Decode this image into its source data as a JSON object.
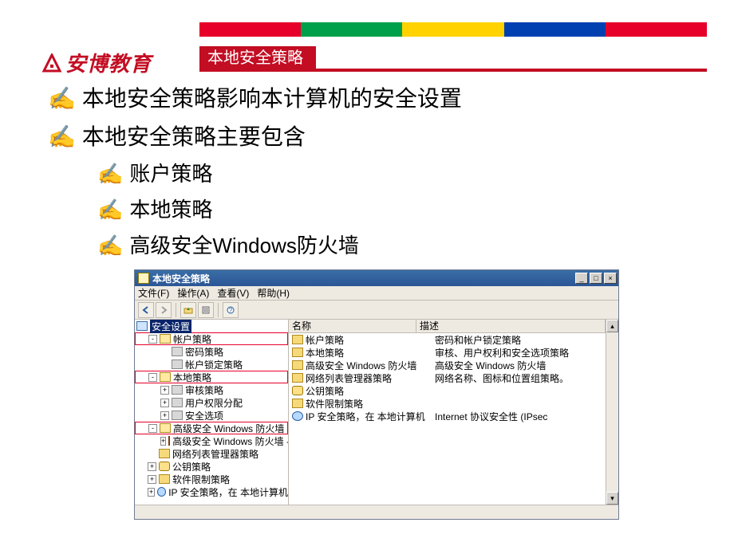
{
  "slide": {
    "logo_text": "安博教育",
    "title": "本地安全策略",
    "bullets_level1": [
      "本地安全策略影响本计算机的安全设置",
      "本地安全策略主要包含"
    ],
    "bullets_level2": [
      "账户策略",
      "本地策略",
      "高级安全Windows防火墙"
    ]
  },
  "mmc": {
    "window_title": "本地安全策略",
    "menu": {
      "file": "文件(F)",
      "action": "操作(A)",
      "view": "查看(V)",
      "help": "帮助(H)"
    },
    "sysbuttons": {
      "min": "_",
      "max": "□",
      "close": "×"
    },
    "tree": {
      "root": "安全设置",
      "nodes": [
        {
          "pm": "-",
          "icon": "folderopen",
          "label": "帐户策略",
          "highlight": true,
          "depth": 1
        },
        {
          "pm": "",
          "icon": "node",
          "label": "密码策略",
          "depth": 2
        },
        {
          "pm": "",
          "icon": "node",
          "label": "帐户锁定策略",
          "depth": 2
        },
        {
          "pm": "-",
          "icon": "folderopen",
          "label": "本地策略",
          "highlight": true,
          "depth": 1
        },
        {
          "pm": "+",
          "icon": "node",
          "label": "审核策略",
          "depth": 2
        },
        {
          "pm": "+",
          "icon": "node",
          "label": "用户权限分配",
          "depth": 2
        },
        {
          "pm": "+",
          "icon": "node",
          "label": "安全选项",
          "depth": 2
        },
        {
          "pm": "-",
          "icon": "folderopen",
          "label": "高级安全 Windows 防火墙",
          "highlight": true,
          "depth": 1
        },
        {
          "pm": "+",
          "icon": "wall",
          "label": "高级安全 Windows 防火墙 - 本地",
          "depth": 2
        },
        {
          "pm": "",
          "icon": "folder",
          "label": "网络列表管理器策略",
          "depth": 1
        },
        {
          "pm": "+",
          "icon": "key",
          "label": "公钥策略",
          "depth": 1
        },
        {
          "pm": "+",
          "icon": "folder",
          "label": "软件限制策略",
          "depth": 1
        },
        {
          "pm": "+",
          "icon": "globe",
          "label": "IP 安全策略，在 本地计算机",
          "depth": 1
        }
      ]
    },
    "list": {
      "col_name": "名称",
      "col_desc": "描述",
      "rows": [
        {
          "icon": "folder",
          "name": "帐户策略",
          "desc": "密码和帐户锁定策略"
        },
        {
          "icon": "folder",
          "name": "本地策略",
          "desc": "审核、用户权利和安全选项策略"
        },
        {
          "icon": "folder",
          "name": "高级安全 Windows 防火墙",
          "desc": "高级安全 Windows 防火墙"
        },
        {
          "icon": "folder",
          "name": "网络列表管理器策略",
          "desc": "网络名称、图标和位置组策略。"
        },
        {
          "icon": "key",
          "name": "公钥策略",
          "desc": ""
        },
        {
          "icon": "folder",
          "name": "软件限制策略",
          "desc": ""
        },
        {
          "icon": "globe",
          "name": "IP 安全策略，在 本地计算机",
          "desc": "Internet 协议安全性 (IPsec"
        }
      ]
    }
  }
}
